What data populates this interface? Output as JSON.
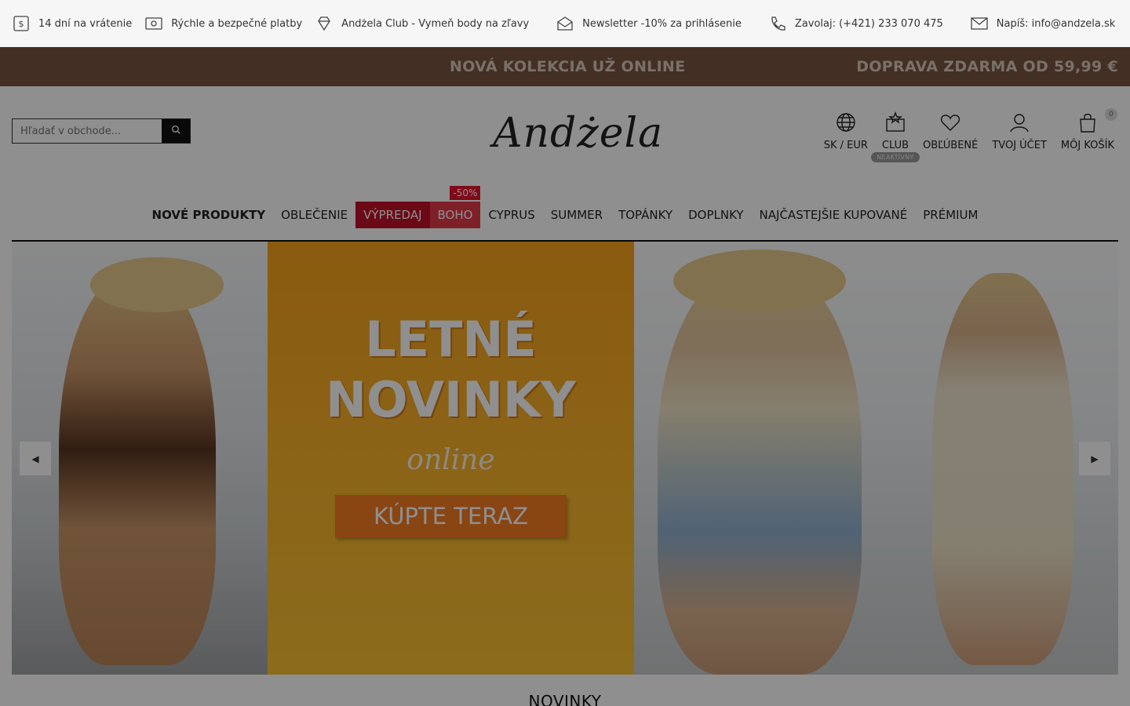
{
  "infobar": {
    "items": [
      {
        "icon": "return-money-icon",
        "label": "14 dní na vrátenie"
      },
      {
        "icon": "payment-card-icon",
        "label": "Rýchle a bezpečné platby"
      },
      {
        "icon": "diamond-icon",
        "label": "Andżela Club - Vymeň body na zľavy"
      },
      {
        "icon": "newsletter-icon",
        "label": "Newsletter -10% za prihlásenie"
      },
      {
        "icon": "phone-icon",
        "label": "Zavolaj: (+421) 233 070 475"
      },
      {
        "icon": "mail-icon",
        "label": "Napíš: info@andzela.sk"
      }
    ]
  },
  "promo": {
    "left": "NOVÁ KOLEKCIA UŽ ONLINE",
    "right": "DOPRAVA ZDARMA OD 59,99 €"
  },
  "header": {
    "search_placeholder": "Hľadať v obchode...",
    "logo": "Andżela",
    "icons": [
      {
        "icon": "globe-icon",
        "label": "SK / EUR"
      },
      {
        "icon": "club-icon",
        "label": "CLUB",
        "badge": "NEAKTÍVNY"
      },
      {
        "icon": "heart-icon",
        "label": "OBĽÚBENÉ"
      },
      {
        "icon": "user-icon",
        "label": "TVOJ ÚČET"
      },
      {
        "icon": "cart-icon",
        "label": "MÔJ KOŠÍK",
        "count": "0"
      }
    ]
  },
  "nav": {
    "items": [
      "NOVÉ PRODUKTY",
      "OBLEČENIE",
      "VÝPREDAJ",
      "BOHO",
      "CYPRUS",
      "SUMMER",
      "TOPÁNKY",
      "DOPLNKY",
      "NAJČASTEJŠIE KUPOVANÉ",
      "PRÉMIUM"
    ],
    "sale_badge": "-50%"
  },
  "hero": {
    "title_line1": "LETNÉ",
    "title_line2": "NOVINKY",
    "subtitle": "online",
    "button": "KÚPTE TERAZ",
    "prev": "◀",
    "next": "▶"
  },
  "section": {
    "title": "NOVINKY"
  },
  "colors": {
    "promo_bg": "#7a5440",
    "sale": "#c0102a",
    "hero_orange": "#f8b22b",
    "button_orange": "#f57c21"
  }
}
